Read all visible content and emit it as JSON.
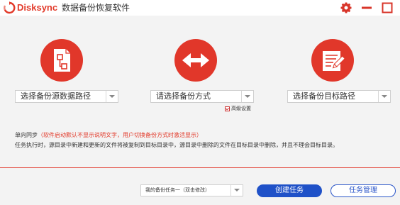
{
  "titlebar": {
    "brand": "Disksync",
    "app_title": "数据备份恢复软件"
  },
  "icons": {
    "source": "source-file-tree-icon",
    "mode": "two-way-arrow-icon",
    "target": "edit-document-icon"
  },
  "colors": {
    "accent": "#e1372a",
    "primary_button": "#1f51c8"
  },
  "selectors": {
    "source": "选择备份源数据路径",
    "mode": "请选择备份方式",
    "target": "选择备份目标路径"
  },
  "advanced": {
    "label": "高级设置",
    "checked": true
  },
  "info": {
    "mode_name": "单向同步",
    "note": "（软件启动默认不显示说明文字，用户切换备份方式时激活显示）",
    "description": "任务执行时，源目录中新建和更新的文件将被复制到目标目录中，源目录中删除的文件在目标目录中删除，并且不理会目标目录。"
  },
  "footer": {
    "task_name": "我的备份任务一（双击修改）",
    "create_button": "创建任务",
    "manage_button": "任务管理"
  }
}
